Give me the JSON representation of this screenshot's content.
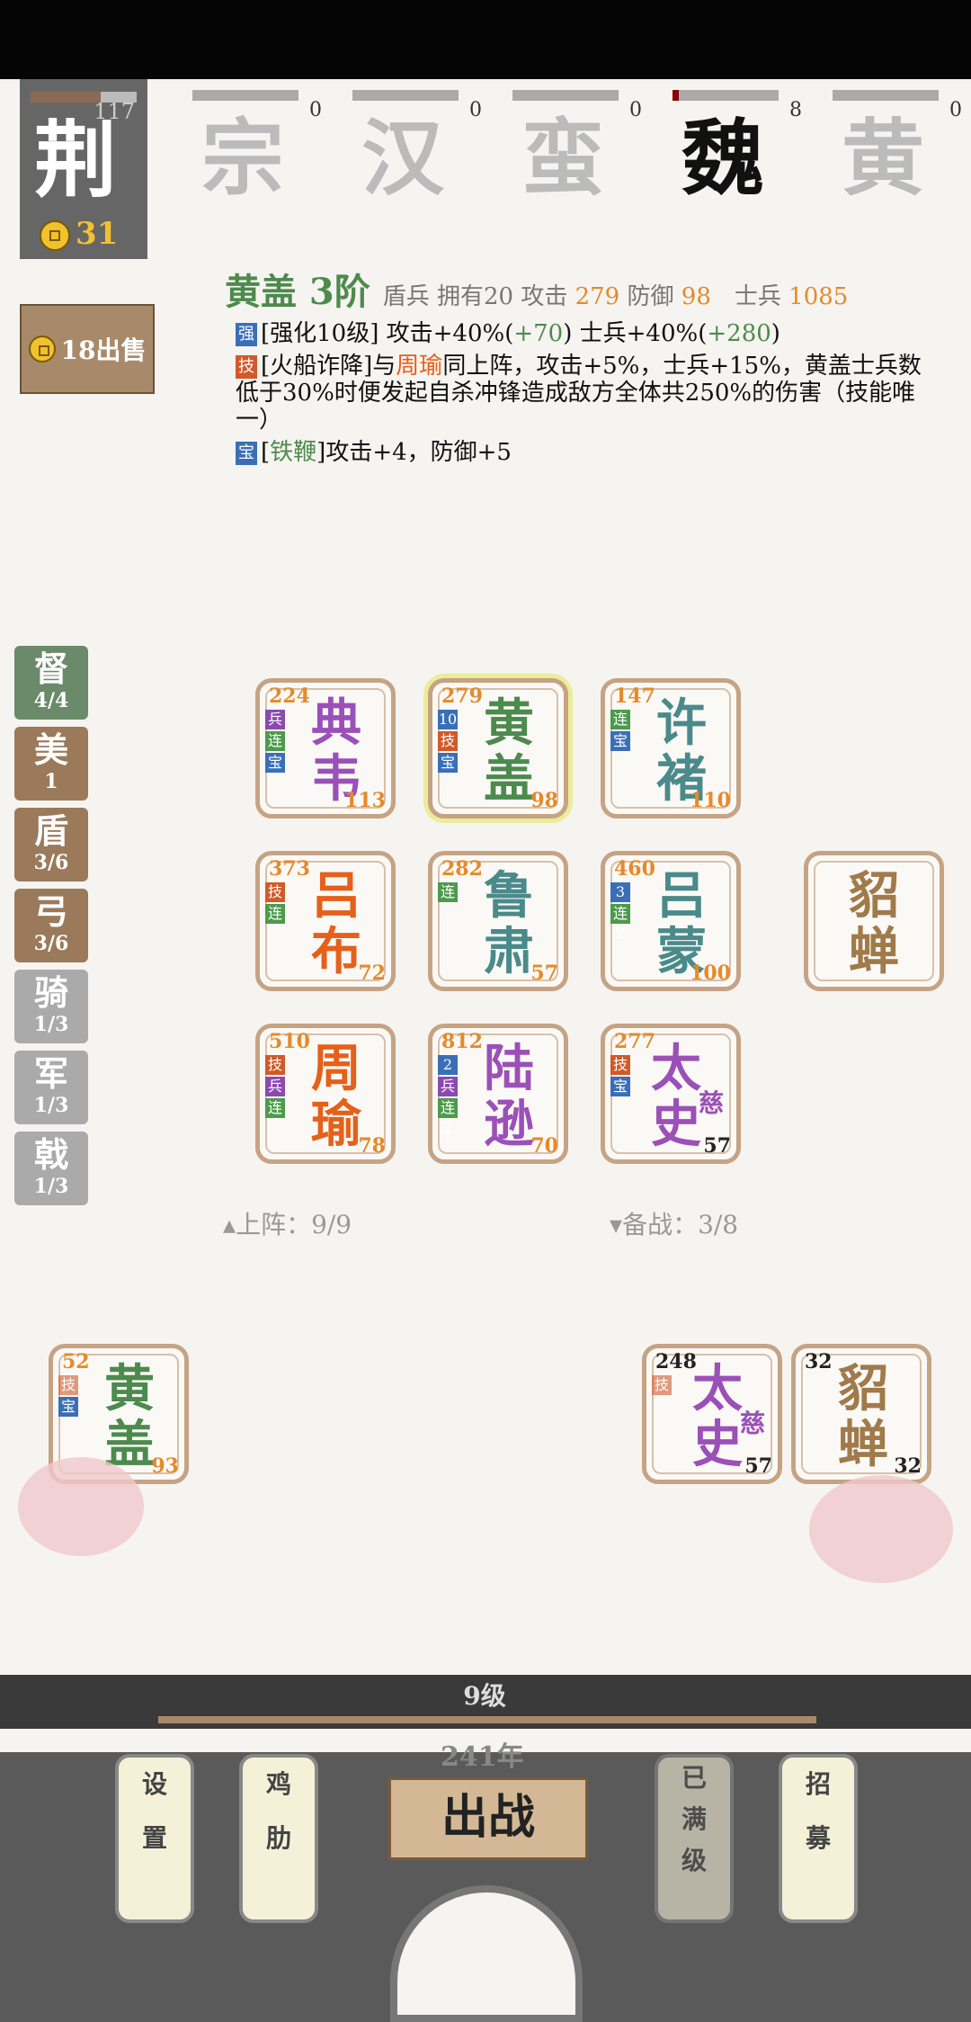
{
  "factions": {
    "current": {
      "name": "荆",
      "count": "117",
      "gold": "31"
    },
    "others": [
      {
        "name": "宗",
        "count": "0"
      },
      {
        "name": "汉",
        "count": "0"
      },
      {
        "name": "蛮",
        "count": "0"
      },
      {
        "name": "魏",
        "count": "8"
      },
      {
        "name": "黄",
        "count": "0"
      }
    ]
  },
  "sell_label": "18出售",
  "info": {
    "name_rank": "黄盖 3阶",
    "meta": "盾兵  拥有20 攻击",
    "attack": "279",
    "def_label": "防御",
    "defense": "98",
    "soldier_label": "士兵",
    "soldiers": "1085",
    "line1_tag": "强",
    "line1": "[强化10级] 攻击+40%(",
    "line1_v1": "+70",
    "line1_mid": ") 士兵+40%(",
    "line1_v2": "+280",
    "line1_end": ")",
    "line2_tag": "技",
    "line2_a": "[火船诈降]与",
    "line2_b": "周瑜",
    "line2_c": "同上阵，攻击+5%，士兵+15%，黄盖士兵数低于30%时便发起自杀冲锋造成敌方全体共250%的伤害（技能唯一）",
    "line3_tag": "宝",
    "line3_a": "[",
    "line3_b": "铁鞭",
    "line3_c": "]攻击+4，防御+5"
  },
  "side_tabs": [
    {
      "label": "督",
      "count": "4/4",
      "color": "#6a8a6a"
    },
    {
      "label": "美",
      "count": "1",
      "color": "#9a7a5a"
    },
    {
      "label": "盾",
      "count": "3/6",
      "color": "#9a7a5a"
    },
    {
      "label": "弓",
      "count": "3/6",
      "color": "#9a7a5a"
    },
    {
      "label": "骑",
      "count": "1/3",
      "color": "#aaaaaa"
    },
    {
      "label": "军",
      "count": "1/3",
      "color": "#aaaaaa"
    },
    {
      "label": "戟",
      "count": "1/3",
      "color": "#aaaaaa"
    }
  ],
  "cards": {
    "dianwei": {
      "n1": "典",
      "n2": "韦",
      "lv": "224",
      "ct": "113",
      "tags": [
        "兵",
        "连",
        "宝"
      ]
    },
    "huanggai": {
      "n1": "黄",
      "n2": "盖",
      "lv": "279",
      "ct": "98",
      "tags": [
        "10",
        "技",
        "宝"
      ]
    },
    "xuchu": {
      "n1": "许",
      "n2": "褚",
      "lv": "147",
      "ct": "110",
      "tags": [
        "连",
        "宝"
      ]
    },
    "lvbu": {
      "n1": "吕",
      "n2": "布",
      "lv": "373",
      "ct": "72",
      "tags": [
        "技",
        "连"
      ]
    },
    "lusu": {
      "n1": "鲁",
      "n2": "肃",
      "lv": "282",
      "ct": "57",
      "tags": [
        "连"
      ]
    },
    "lvmeng": {
      "n1": "吕",
      "n2": "蒙",
      "lv": "460",
      "ct": "100",
      "tags": [
        "3",
        "连2"
      ]
    },
    "diaochan": {
      "n1": "貂",
      "n2": "蝉"
    },
    "zhouyu": {
      "n1": "周",
      "n2": "瑜",
      "lv": "510",
      "ct": "78",
      "tags": [
        "技",
        "兵",
        "连"
      ]
    },
    "luxun": {
      "n1": "陆",
      "n2": "逊",
      "lv": "812",
      "ct": "70",
      "tags": [
        "2",
        "兵",
        "连2"
      ]
    },
    "taishi": {
      "n1": "太",
      "n2": "史",
      "sub": "慈",
      "lv": "277",
      "ct": "57",
      "tags": [
        "技",
        "宝"
      ]
    }
  },
  "lineup_label": "上阵：9/9",
  "reserve_label": "备战：3/8",
  "bench": {
    "huanggai": {
      "n1": "黄",
      "n2": "盖",
      "lv": "52",
      "ct": "93",
      "tags": [
        "技",
        "宝"
      ]
    },
    "taishi": {
      "n1": "太",
      "n2": "史",
      "sub": "慈",
      "lv": "248",
      "ct": "57",
      "tags": [
        "技"
      ]
    },
    "diaochan": {
      "n1": "貂",
      "n2": "蝉",
      "lv": "32",
      "ct": "32"
    }
  },
  "level": "9级",
  "year": "241年",
  "buttons": {
    "settings": [
      "设",
      "置"
    ],
    "chicken": [
      "鸡",
      "肋"
    ],
    "battle": "出战",
    "maxed": [
      "已",
      "满",
      "级"
    ],
    "recruit": [
      "招",
      "募"
    ]
  }
}
